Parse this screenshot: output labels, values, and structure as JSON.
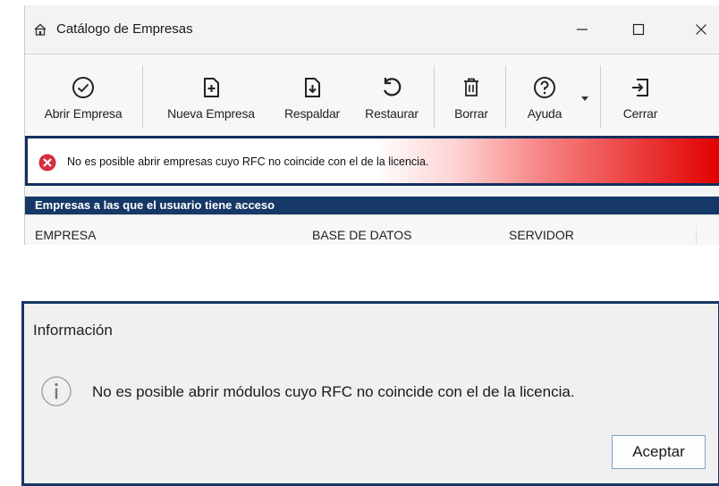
{
  "window": {
    "title": "Catálogo de Empresas",
    "controls": {
      "minimize": "—",
      "maximize": "☐",
      "close": "✕"
    }
  },
  "toolbar": {
    "items": [
      {
        "label": "Abrir Empresa",
        "icon": "check-circle-icon"
      },
      {
        "label": "Nueva Empresa",
        "icon": "new-file-icon"
      },
      {
        "label": "Respaldar",
        "icon": "backup-icon"
      },
      {
        "label": "Restaurar",
        "icon": "restore-icon"
      },
      {
        "label": "Borrar",
        "icon": "trash-icon"
      },
      {
        "label": "Ayuda",
        "icon": "help-icon"
      },
      {
        "label": "Cerrar",
        "icon": "exit-icon"
      }
    ]
  },
  "error_banner": {
    "message": "No es posible abrir empresas cuyo RFC no coincide con el de la licencia.",
    "icon": "error-icon"
  },
  "grid": {
    "section_title": "Empresas a las que el usuario tiene acceso",
    "columns": [
      "EMPRESA",
      "BASE DE DATOS",
      "SERVIDOR"
    ]
  },
  "dialog": {
    "title": "Información",
    "message": "No es posible abrir módulos cuyo RFC no coincide con el de la licencia.",
    "icon": "info-icon",
    "ok_label": "Aceptar"
  },
  "colors": {
    "accent_dark_blue": "#163866",
    "error_red": "#e30000",
    "dialog_button_border": "#7a9fd0"
  }
}
